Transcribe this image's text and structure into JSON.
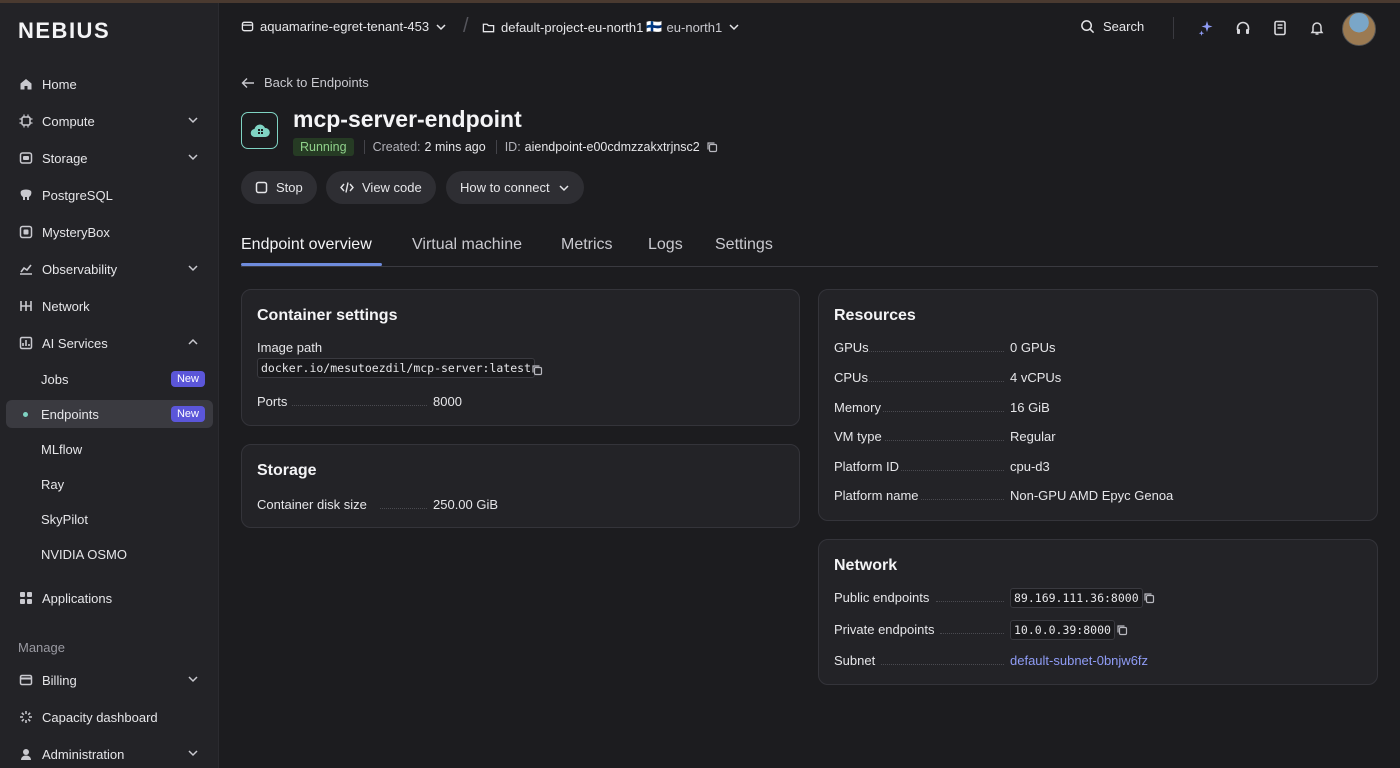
{
  "brand": "NEBIUS",
  "sidebar": {
    "items": [
      {
        "label": "Home"
      },
      {
        "label": "Compute"
      },
      {
        "label": "Storage"
      },
      {
        "label": "PostgreSQL"
      },
      {
        "label": "MysteryBox"
      },
      {
        "label": "Observability"
      },
      {
        "label": "Network"
      },
      {
        "label": "AI Services"
      },
      {
        "label": "Jobs",
        "badge": "New"
      },
      {
        "label": "Endpoints",
        "badge": "New"
      },
      {
        "label": "MLflow"
      },
      {
        "label": "Ray"
      },
      {
        "label": "SkyPilot"
      },
      {
        "label": "NVIDIA OSMO"
      },
      {
        "label": "Applications"
      },
      {
        "label": "Billing"
      },
      {
        "label": "Capacity dashboard"
      },
      {
        "label": "Administration"
      }
    ],
    "manage_label": "Manage"
  },
  "topbar": {
    "tenant": "aquamarine-egret-tenant-453",
    "project": "default-project-eu-north1",
    "region": "eu-north1",
    "region_flag": "🇫🇮",
    "search_label": "Search"
  },
  "page": {
    "back_label": "Back to Endpoints",
    "title": "mcp-server-endpoint",
    "status": "Running",
    "created_label": "Created:",
    "created_value": "2 mins ago",
    "id_label": "ID:",
    "id_value": "aiendpoint-e00cdmzzakxtrjnsc2",
    "buttons": {
      "stop": "Stop",
      "view_code": "View code",
      "how_to_connect": "How to connect"
    },
    "tabs": [
      "Endpoint overview",
      "Virtual machine",
      "Metrics",
      "Logs",
      "Settings"
    ]
  },
  "container_settings": {
    "title": "Container settings",
    "image_path_label": "Image path",
    "image_path": "docker.io/mesutoezdil/mcp-server:latest",
    "ports_label": "Ports",
    "ports": "8000"
  },
  "storage": {
    "title": "Storage",
    "disk_label": "Container disk size",
    "disk_value": "250.00 GiB"
  },
  "resources": {
    "title": "Resources",
    "rows": [
      {
        "label": "GPUs",
        "value": "0 GPUs"
      },
      {
        "label": "CPUs",
        "value": "4 vCPUs"
      },
      {
        "label": "Memory",
        "value": "16 GiB"
      },
      {
        "label": "VM type",
        "value": "Regular"
      },
      {
        "label": "Platform ID",
        "value": "cpu-d3"
      },
      {
        "label": "Platform name",
        "value": "Non-GPU AMD Epyc Genoa"
      }
    ]
  },
  "network": {
    "title": "Network",
    "public_label": "Public endpoints",
    "public_value": "89.169.111.36:8000",
    "private_label": "Private endpoints",
    "private_value": "10.0.0.39:8000",
    "subnet_label": "Subnet",
    "subnet_value": "default-subnet-0bnjw6fz"
  },
  "colors": {
    "accent": "#6e8bdc",
    "badge": "#5b56d9",
    "status_green": "#8fd18a",
    "teal": "#7fd3c3",
    "link": "#8f9cf5"
  }
}
